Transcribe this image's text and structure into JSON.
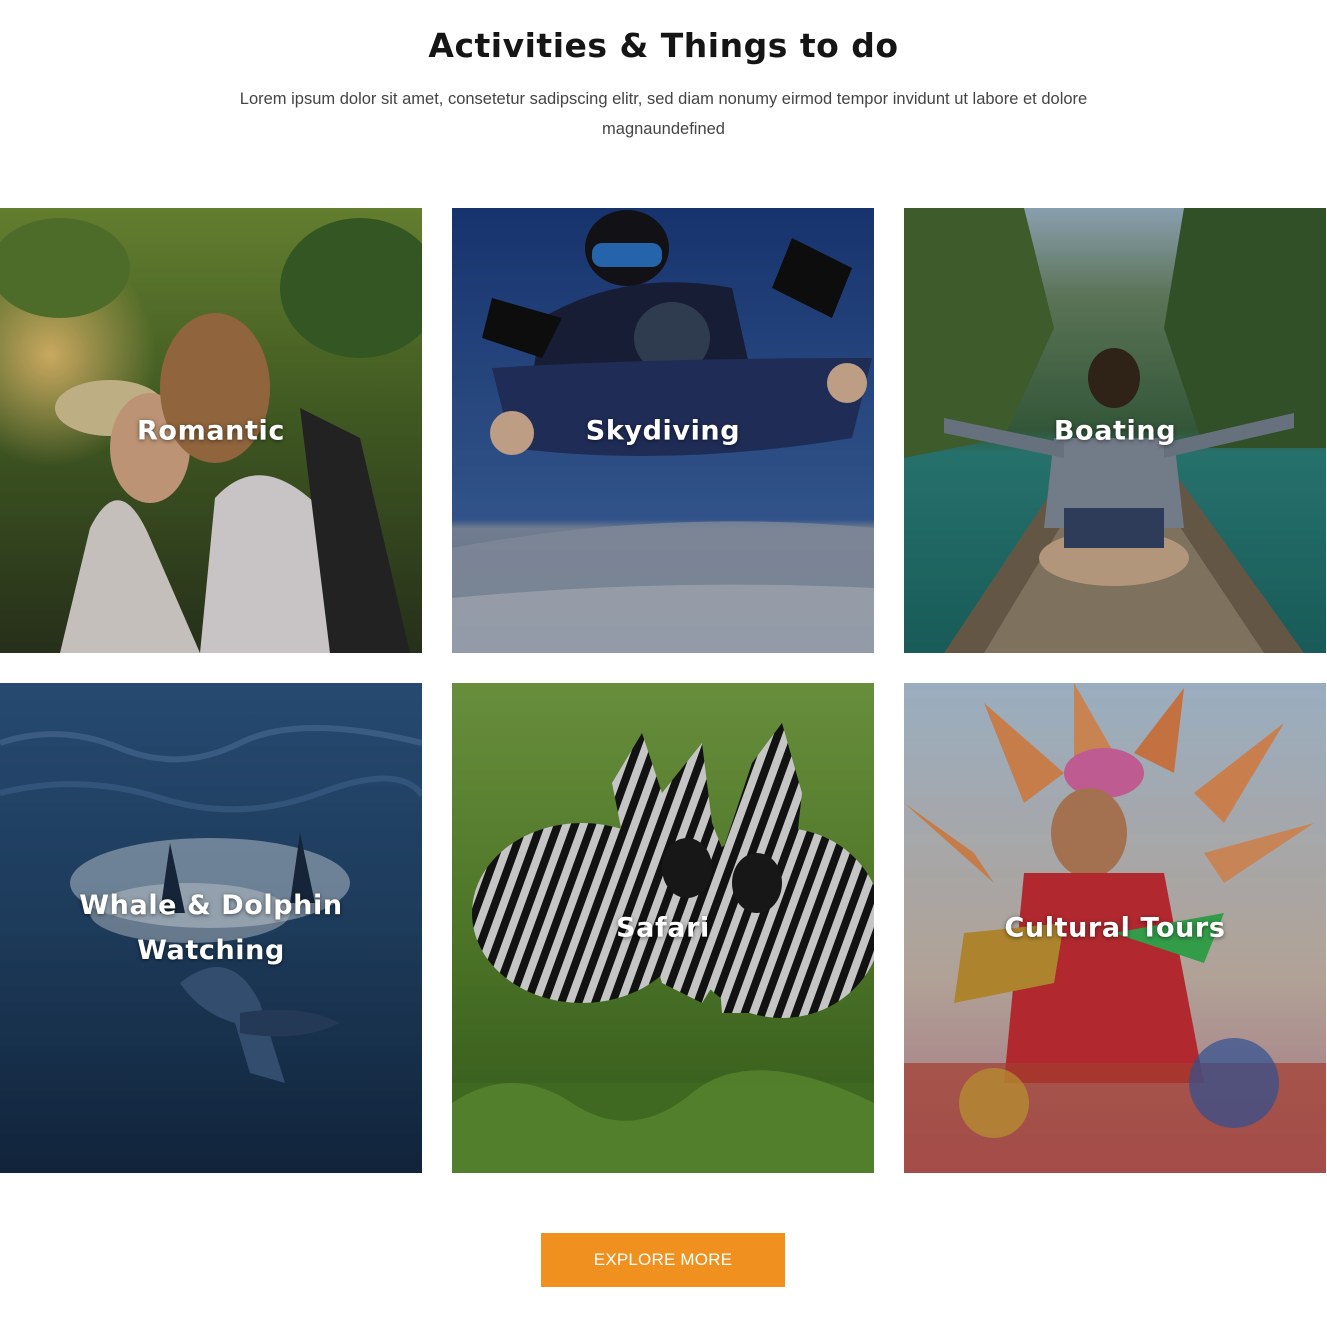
{
  "header": {
    "title": "Activities & Things to do",
    "subtitle": "Lorem ipsum dolor sit amet, consetetur sadipscing elitr, sed diam nonumy eirmod tempor invidunt ut labore et dolore magnaundefined"
  },
  "activities": [
    {
      "label": "Romantic",
      "image": "couple-kissing-jungle"
    },
    {
      "label": "Skydiving",
      "image": "tandem-skydivers"
    },
    {
      "label": "Boating",
      "image": "woman-on-longtail-boat"
    },
    {
      "label": "Whale & Dolphin Watching",
      "image": "dolphin-in-ocean"
    },
    {
      "label": "Safari",
      "image": "zebras"
    },
    {
      "label": "Cultural Tours",
      "image": "festival-dancer"
    }
  ],
  "cta": {
    "label": "EXPLORE MORE"
  },
  "colors": {
    "accent": "#F0911F",
    "title": "#151515",
    "body_text": "#444444"
  }
}
